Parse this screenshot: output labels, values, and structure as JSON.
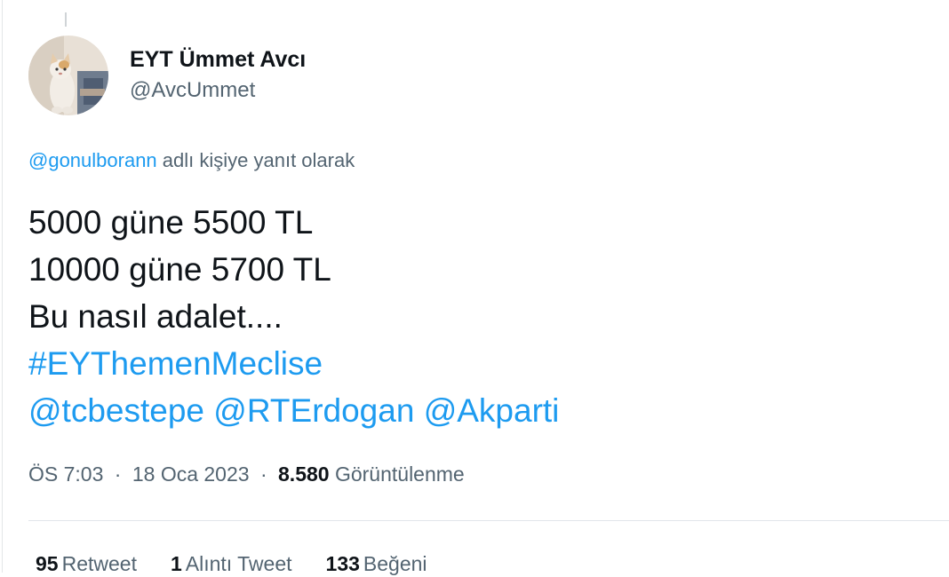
{
  "author": {
    "display_name": "EYT Ümmet Avcı",
    "handle": "@AvcUmmet",
    "avatar_icon": "cat-photo-avatar"
  },
  "reply": {
    "mention": "@gonulborann",
    "suffix": "adlı kişiye yanıt olarak"
  },
  "tweet": {
    "line1": "5000 güne 5500 TL",
    "line2": "10000 güne 5700 TL",
    "line3": "Bu nasıl adalet....",
    "hashtag": "#EYThemenMeclise",
    "mentions": [
      "@tcbestepe",
      "@RTErdogan",
      "@Akparti"
    ]
  },
  "meta": {
    "time": "ÖS 7:03",
    "separator": "·",
    "date": "18 Oca 2023",
    "views_count": "8.580",
    "views_label": "Görüntülenme"
  },
  "stats": {
    "retweets": {
      "count": "95",
      "label": "Retweet"
    },
    "quotes": {
      "count": "1",
      "label": "Alıntı Tweet"
    },
    "likes": {
      "count": "133",
      "label": "Beğeni"
    }
  },
  "colors": {
    "link": "#1d9bf0",
    "secondary_text": "#536471",
    "primary_text": "#0f1419"
  }
}
